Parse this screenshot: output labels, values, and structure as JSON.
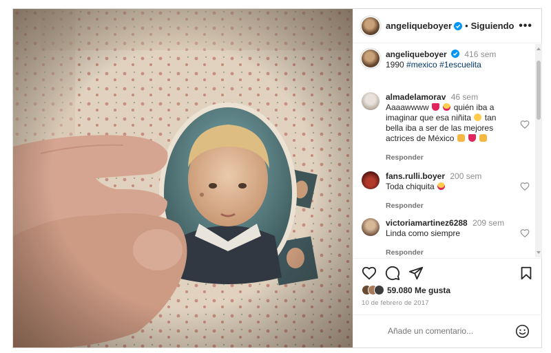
{
  "post": {
    "author": "angeliqueboyer",
    "follow_state": "Siguiendo",
    "more_label": "•••",
    "caption": {
      "username": "angeliqueboyer",
      "age": "416 sem",
      "year": "1990",
      "hashtags": [
        "#mexico",
        "#1escuelita"
      ]
    },
    "comments": [
      {
        "username": "almadelamorav",
        "age": "46 sem",
        "text_1": "Aaaawwww",
        "text_2": "quién iba a imaginar que esa niñita",
        "text_3": "tan bella iba a ser de las mejores actrices de México",
        "reply": "Responder",
        "emoji": [
          "red-heart",
          "heart-eyes",
          "baby",
          "clap",
          "red-heart",
          "raised-hands"
        ]
      },
      {
        "username": "fans.rulli.boyer",
        "age": "200 sem",
        "text_1": "Toda chiquita",
        "reply": "Responder",
        "emoji": [
          "heart-eyes"
        ]
      },
      {
        "username": "victoriamartinez6288",
        "age": "209 sem",
        "text_1": "Linda como siempre",
        "reply": "Responder"
      }
    ],
    "likes": "59.080 Me gusta",
    "date": "10 de febrero de 2017",
    "comment_placeholder": "Añade un comentario..."
  },
  "colors": {
    "verified": "#0095f6",
    "hashtag": "#00376b",
    "heart": "#ed4956",
    "muted": "#8e8e8e"
  },
  "icons": [
    "like-icon",
    "comment-icon",
    "share-icon",
    "bookmark-icon",
    "emoji-icon",
    "more-icon",
    "verified-icon"
  ]
}
